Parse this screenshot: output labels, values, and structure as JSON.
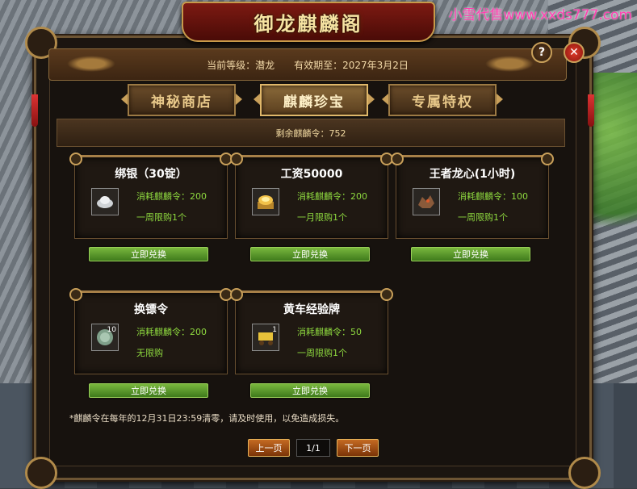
{
  "watermark": "小雪代售www.xxds777.com",
  "window": {
    "title": "御龙麒麟阁"
  },
  "header": {
    "level_label": "当前等级：潜龙",
    "expiry_label": "有效期至：2027年3月2日"
  },
  "controls": {
    "help": "?",
    "close": "✕"
  },
  "tabs": [
    {
      "label": "神秘商店",
      "active": false
    },
    {
      "label": "麒麟珍宝",
      "active": true
    },
    {
      "label": "专属特权",
      "active": false
    }
  ],
  "balance": {
    "text": "剩余麒麟令：752"
  },
  "items": [
    {
      "name": "绑银（30锭）",
      "icon": "silver-ingot-icon",
      "qty": "",
      "cost": "消耗麒麟令：200",
      "limit": "一周限购1个",
      "button": "立即兑换"
    },
    {
      "name": "工资50000",
      "icon": "gold-coins-icon",
      "qty": "",
      "cost": "消耗麒麟令：200",
      "limit": "一月限购1个",
      "button": "立即兑换"
    },
    {
      "name": "王者龙心(1小时)",
      "icon": "dragon-heart-icon",
      "qty": "",
      "cost": "消耗麒麟令：100",
      "limit": "一周限购1个",
      "button": "立即兑换"
    },
    {
      "name": "换镖令",
      "icon": "token-coin-icon",
      "qty": "10",
      "cost": "消耗麒麟令：200",
      "limit": "无限购",
      "button": "立即兑换"
    },
    {
      "name": "黄车经验牌",
      "icon": "yellow-cart-icon",
      "qty": "1",
      "cost": "消耗麒麟令：50",
      "limit": "一周限购1个",
      "button": "立即兑换"
    }
  ],
  "note": "*麒麟令在每年的12月31日23:59清零，请及时使用，以免造成损失。",
  "pager": {
    "prev": "上一页",
    "page": "1/1",
    "next": "下一页"
  },
  "colors": {
    "accent_green": "#8ed93f",
    "button_green": "#5a9a2c",
    "close_red": "#c4281b",
    "gold": "#c9a05a"
  }
}
